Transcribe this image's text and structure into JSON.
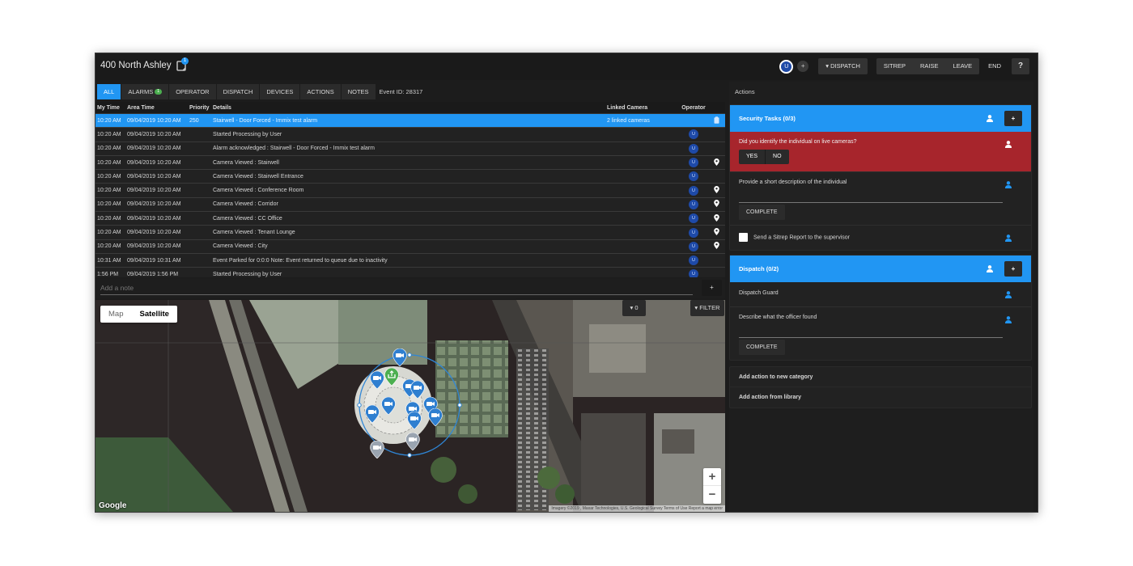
{
  "header": {
    "title": "400 North Ashley",
    "notes_badge": "1",
    "user_initial": "U",
    "add_user": "+",
    "dispatch": "▾ DISPATCH",
    "sitrep": "SITREP",
    "raise": "RAISE",
    "leave": "LEAVE",
    "end": "END",
    "help": "?"
  },
  "tabs": [
    {
      "label": "ALL",
      "active": true
    },
    {
      "label": "ALARMS",
      "badge": "1"
    },
    {
      "label": "OPERATOR"
    },
    {
      "label": "DISPATCH"
    },
    {
      "label": "DEVICES"
    },
    {
      "label": "ACTIONS"
    },
    {
      "label": "NOTES"
    }
  ],
  "event_id": "Event ID: 28317",
  "grid": {
    "columns": [
      "My Time",
      "Area Time",
      "Priority",
      "Details",
      "Linked Camera",
      "Operator"
    ],
    "rows": [
      {
        "my": "10:20 AM",
        "area": "09/04/2019 10:20 AM",
        "pri": "250",
        "det": "Stairwell - Door Forced - Immix test alarm",
        "cam": "2 linked cameras",
        "op": "",
        "icon": "clipboard",
        "selected": true
      },
      {
        "my": "10:20 AM",
        "area": "09/04/2019 10:20 AM",
        "pri": "",
        "det": "Started Processing by User",
        "cam": "",
        "op": "U",
        "icon": ""
      },
      {
        "my": "10:20 AM",
        "area": "09/04/2019 10:20 AM",
        "pri": "",
        "det": "Alarm acknowledged : Stairwell - Door Forced - Immix test alarm",
        "cam": "",
        "op": "U",
        "icon": ""
      },
      {
        "my": "10:20 AM",
        "area": "09/04/2019 10:20 AM",
        "pri": "",
        "det": "Camera Viewed : Stairwell",
        "cam": "",
        "op": "U",
        "icon": "pin"
      },
      {
        "my": "10:20 AM",
        "area": "09/04/2019 10:20 AM",
        "pri": "",
        "det": "Camera Viewed : Stairwell Entrance",
        "cam": "",
        "op": "U",
        "icon": ""
      },
      {
        "my": "10:20 AM",
        "area": "09/04/2019 10:20 AM",
        "pri": "",
        "det": "Camera Viewed : Conference Room",
        "cam": "",
        "op": "U",
        "icon": "pin"
      },
      {
        "my": "10:20 AM",
        "area": "09/04/2019 10:20 AM",
        "pri": "",
        "det": "Camera Viewed : Corridor",
        "cam": "",
        "op": "U",
        "icon": "pin"
      },
      {
        "my": "10:20 AM",
        "area": "09/04/2019 10:20 AM",
        "pri": "",
        "det": "Camera Viewed : CC Office",
        "cam": "",
        "op": "U",
        "icon": "pin"
      },
      {
        "my": "10:20 AM",
        "area": "09/04/2019 10:20 AM",
        "pri": "",
        "det": "Camera Viewed : Tenant Lounge",
        "cam": "",
        "op": "U",
        "icon": "pin"
      },
      {
        "my": "10:20 AM",
        "area": "09/04/2019 10:20 AM",
        "pri": "",
        "det": "Camera Viewed : City",
        "cam": "",
        "op": "U",
        "icon": "pin"
      },
      {
        "my": "10:31 AM",
        "area": "09/04/2019 10:31 AM",
        "pri": "",
        "det": "Event Parked for 0:0:0 Note: Event returned to queue due to inactivity",
        "cam": "",
        "op": "U",
        "icon": ""
      },
      {
        "my": "1:56 PM",
        "area": "09/04/2019 1:56 PM",
        "pri": "",
        "det": "Started Processing by User",
        "cam": "",
        "op": "U",
        "icon": ""
      }
    ]
  },
  "note": {
    "placeholder": "Add a note",
    "add": "+"
  },
  "map": {
    "type_map": "Map",
    "type_satellite": "Satellite",
    "selected_type": "Satellite",
    "layer_count": "▾ 0",
    "filter": "▾ FILTER",
    "zoom_in": "+",
    "zoom_out": "−",
    "logo": "Google",
    "attribution": "Imagery ©2019 , Maxar Technologies, U.S. Geological Survey    Terms of Use    Report a map error"
  },
  "actions": {
    "title": "Actions",
    "categories": [
      {
        "title": "Security Tasks (0/3)",
        "add": "+",
        "tasks": [
          {
            "text": "Did you identify the individual on live cameras?",
            "type": "yes_no",
            "yes": "YES",
            "no": "NO",
            "highlight": true
          },
          {
            "text": "Provide a short description of the individual",
            "type": "text",
            "complete": "COMPLETE"
          },
          {
            "text": "Send a Sitrep Report to the supervisor",
            "type": "checkbox",
            "checked": false
          }
        ]
      },
      {
        "title": "Dispatch (0/2)",
        "add": "+",
        "tasks": [
          {
            "text": "Dispatch Guard",
            "type": "plain"
          },
          {
            "text": "Describe what the officer found",
            "type": "text",
            "complete": "COMPLETE"
          }
        ]
      }
    ],
    "add_new_category": "Add action to new category",
    "add_from_library": "Add action from library"
  },
  "colors": {
    "accent": "#2196f3",
    "alert": "#a7252c",
    "badge_green": "#4caf50",
    "operator": "#1e4aa8"
  }
}
